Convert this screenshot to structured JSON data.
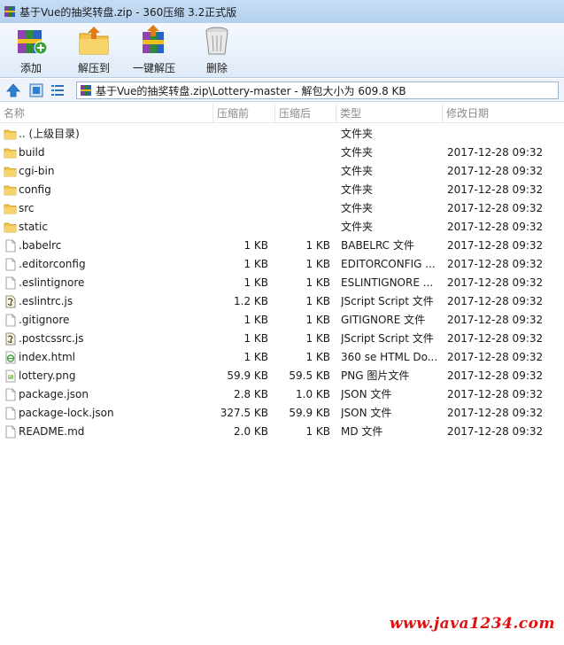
{
  "window": {
    "title": "基于Vue的抽奖转盘.zip - 360压缩 3.2正式版"
  },
  "toolbar": {
    "add_label": "添加",
    "extract_label": "解压到",
    "one_click_label": "一键解压",
    "delete_label": "删除"
  },
  "address": {
    "path": "基于Vue的抽奖转盘.zip\\Lottery-master - 解包大小为 609.8 KB"
  },
  "columns": {
    "name": "名称",
    "size": "压缩前",
    "packed": "压缩后",
    "type": "类型",
    "modified": "修改日期"
  },
  "files": [
    {
      "name": ".. (上级目录)",
      "size": "",
      "packed": "",
      "type": "文件夹",
      "date": "",
      "icon": "folder-up-icon"
    },
    {
      "name": "build",
      "size": "",
      "packed": "",
      "type": "文件夹",
      "date": "2017-12-28 09:32",
      "icon": "folder-icon"
    },
    {
      "name": "cgi-bin",
      "size": "",
      "packed": "",
      "type": "文件夹",
      "date": "2017-12-28 09:32",
      "icon": "folder-icon"
    },
    {
      "name": "config",
      "size": "",
      "packed": "",
      "type": "文件夹",
      "date": "2017-12-28 09:32",
      "icon": "folder-icon"
    },
    {
      "name": "src",
      "size": "",
      "packed": "",
      "type": "文件夹",
      "date": "2017-12-28 09:32",
      "icon": "folder-icon"
    },
    {
      "name": "static",
      "size": "",
      "packed": "",
      "type": "文件夹",
      "date": "2017-12-28 09:32",
      "icon": "folder-icon"
    },
    {
      "name": ".babelrc",
      "size": "1 KB",
      "packed": "1 KB",
      "type": "BABELRC 文件",
      "date": "2017-12-28 09:32",
      "icon": "file-icon"
    },
    {
      "name": ".editorconfig",
      "size": "1 KB",
      "packed": "1 KB",
      "type": "EDITORCONFIG ...",
      "date": "2017-12-28 09:32",
      "icon": "file-icon"
    },
    {
      "name": ".eslintignore",
      "size": "1 KB",
      "packed": "1 KB",
      "type": "ESLINTIGNORE ...",
      "date": "2017-12-28 09:32",
      "icon": "file-icon"
    },
    {
      "name": ".eslintrc.js",
      "size": "1.2 KB",
      "packed": "1 KB",
      "type": "JScript Script 文件",
      "date": "2017-12-28 09:32",
      "icon": "script-file-icon"
    },
    {
      "name": ".gitignore",
      "size": "1 KB",
      "packed": "1 KB",
      "type": "GITIGNORE 文件",
      "date": "2017-12-28 09:32",
      "icon": "file-icon"
    },
    {
      "name": ".postcssrc.js",
      "size": "1 KB",
      "packed": "1 KB",
      "type": "JScript Script 文件",
      "date": "2017-12-28 09:32",
      "icon": "script-file-icon"
    },
    {
      "name": "index.html",
      "size": "1 KB",
      "packed": "1 KB",
      "type": "360 se HTML Do...",
      "date": "2017-12-28 09:32",
      "icon": "html-file-icon"
    },
    {
      "name": "lottery.png",
      "size": "59.9 KB",
      "packed": "59.5 KB",
      "type": "PNG 图片文件",
      "date": "2017-12-28 09:32",
      "icon": "image-file-icon"
    },
    {
      "name": "package.json",
      "size": "2.8 KB",
      "packed": "1.0 KB",
      "type": "JSON 文件",
      "date": "2017-12-28 09:32",
      "icon": "file-icon"
    },
    {
      "name": "package-lock.json",
      "size": "327.5 KB",
      "packed": "59.9 KB",
      "type": "JSON 文件",
      "date": "2017-12-28 09:32",
      "icon": "file-icon"
    },
    {
      "name": "README.md",
      "size": "2.0 KB",
      "packed": "1 KB",
      "type": "MD 文件",
      "date": "2017-12-28 09:32",
      "icon": "file-icon"
    }
  ],
  "watermark": "www.java1234.com"
}
